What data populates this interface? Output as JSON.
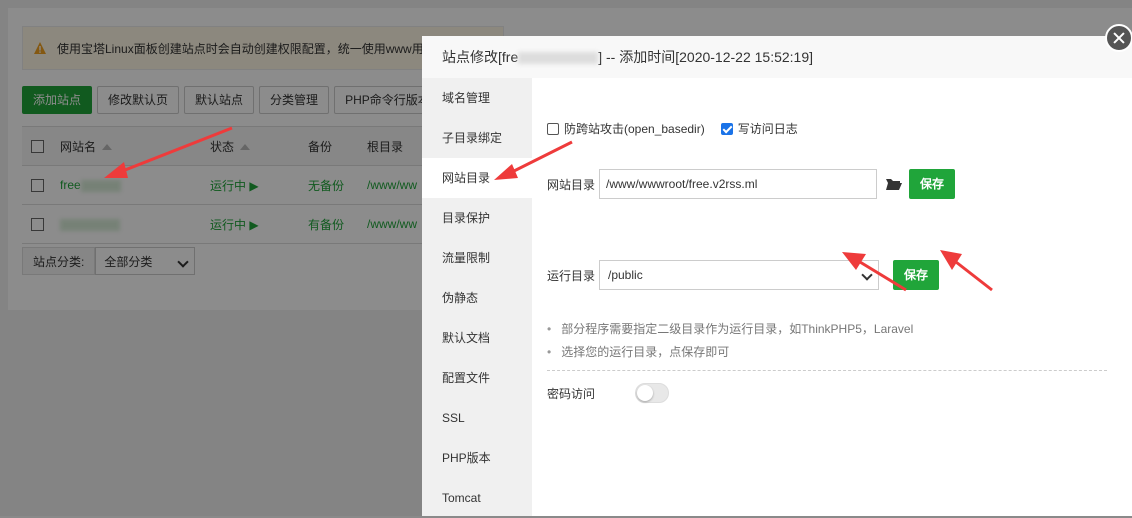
{
  "background": {
    "warning": "使用宝塔Linux面板创建站点时会自动创建权限配置，统一使用www用",
    "buttons": [
      "添加站点",
      "修改默认页",
      "默认站点",
      "分类管理",
      "PHP命令行版本"
    ],
    "table": {
      "headers": [
        "网站名",
        "状态",
        "备份",
        "根目录"
      ],
      "rows": [
        {
          "name": "free",
          "status": "运行中 ▶",
          "backup": "无备份",
          "root": "/www/ww"
        },
        {
          "name": "",
          "status": "运行中 ▶",
          "backup": "有备份",
          "root": "/www/ww"
        }
      ]
    },
    "category_label": "站点分类:",
    "category_value": "全部分类"
  },
  "dialog": {
    "title": "站点修改[fre",
    "title_suffix": "] -- 添加时间[2020-12-22 15:52:19]",
    "menu": [
      "域名管理",
      "子目录绑定",
      "网站目录",
      "目录保护",
      "流量限制",
      "伪静态",
      "默认文档",
      "配置文件",
      "SSL",
      "PHP版本",
      "Tomcat"
    ],
    "active_menu": 2,
    "checkbox1": "防跨站攻击(open_basedir)",
    "checkbox2": "写访问日志",
    "site_dir_label": "网站目录",
    "site_dir_value": "/www/wwwroot/free.v2rss.ml",
    "save_label": "保存",
    "run_dir_label": "运行目录",
    "run_dir_value": "/public",
    "tips": [
      "部分程序需要指定二级目录作为运行目录，如ThinkPHP5，Laravel",
      "选择您的运行目录，点保存即可"
    ],
    "password_label": "密码访问"
  },
  "colors": {
    "accent": "#20a53a",
    "arrow": "#ee3b3b"
  }
}
